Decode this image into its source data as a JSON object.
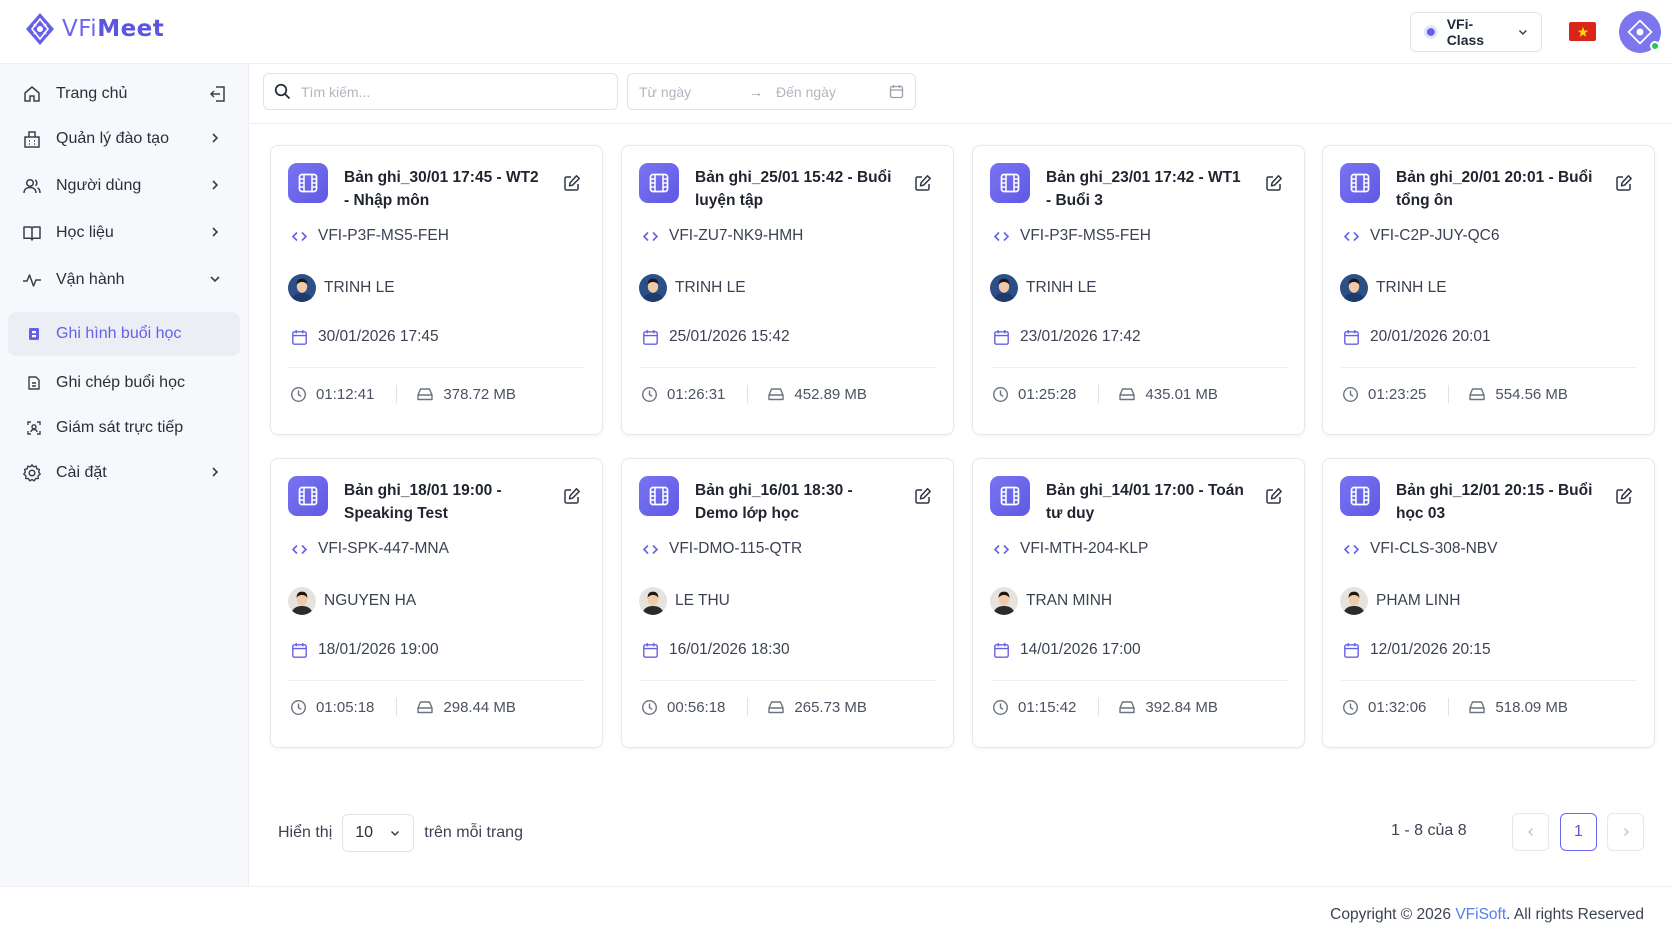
{
  "app": {
    "logo_text_a": "VFi",
    "logo_text_b": "Meet",
    "class_switch": "VFi-Class",
    "brand_color": "#5b55e0"
  },
  "sidebar": {
    "items": [
      {
        "label": "Trang chủ",
        "icon": "home-icon"
      },
      {
        "label": "Quản lý đào tạo",
        "icon": "training-icon"
      },
      {
        "label": "Người dùng",
        "icon": "users-icon"
      },
      {
        "label": "Học liệu",
        "icon": "book-icon"
      },
      {
        "label": "Vận hành",
        "icon": "activity-icon"
      },
      {
        "label": "Ghi hình buổi học",
        "icon": "record-icon"
      },
      {
        "label": "Ghi chép buổi học",
        "icon": "notes-icon"
      },
      {
        "label": "Giám sát trực tiếp",
        "icon": "monitor-icon"
      },
      {
        "label": "Cài đặt",
        "icon": "gear-icon"
      }
    ]
  },
  "toolbar": {
    "search_placeholder": "Tìm kiếm...",
    "date_from": "Từ ngày",
    "date_to": "Đến ngày"
  },
  "recordings": [
    {
      "title": "Bản ghi_30/01 17:45 - WT2 - Nhập môn",
      "code": "VFI-P3F-MS5-FEH",
      "user": "TRINH LE",
      "date": "30/01/2026 17:45",
      "duration": "01:12:41",
      "size": "378.72 MB"
    },
    {
      "title": "Bản ghi_25/01 15:42 - Buổi luyện tập",
      "code": "VFI-ZU7-NK9-HMH",
      "user": "TRINH LE",
      "date": "25/01/2026 15:42",
      "duration": "01:26:31",
      "size": "452.89 MB"
    },
    {
      "title": "Bản ghi_23/01 17:42 - WT1 - Buổi 3",
      "code": "VFI-P3F-MS5-FEH",
      "user": "TRINH LE",
      "date": "23/01/2026 17:42",
      "duration": "01:25:28",
      "size": "435.01 MB"
    },
    {
      "title": "Bản ghi_20/01 20:01 - Buổi tổng ôn",
      "code": "VFI-C2P-JUY-QC6",
      "user": "TRINH LE",
      "date": "20/01/2026 20:01",
      "duration": "01:23:25",
      "size": "554.56 MB"
    },
    {
      "title": "Bản ghi_18/01 19:00 - Speaking Test",
      "code": "VFI-SPK-447-MNA",
      "user": "NGUYEN HA",
      "date": "18/01/2026 19:00",
      "duration": "01:05:18",
      "size": "298.44 MB"
    },
    {
      "title": "Bản ghi_16/01 18:30 - Demo lớp học",
      "code": "VFI-DMO-115-QTR",
      "user": "LE THU",
      "date": "16/01/2026 18:30",
      "duration": "00:56:18",
      "size": "265.73 MB"
    },
    {
      "title": "Bản ghi_14/01 17:00 - Toán tư duy",
      "code": "VFI-MTH-204-KLP",
      "user": "TRAN MINH",
      "date": "14/01/2026 17:00",
      "duration": "01:15:42",
      "size": "392.84 MB"
    },
    {
      "title": "Bản ghi_12/01 20:15 - Buổi học 03",
      "code": "VFI-CLS-308-NBV",
      "user": "PHAM LINH",
      "date": "12/01/2026 20:15",
      "duration": "01:32:06",
      "size": "518.09 MB"
    }
  ],
  "pagination": {
    "show_label": "Hiển thị",
    "page_size": "10",
    "per_page_label": "trên mỗi trang",
    "range": "1 - 8 của 8",
    "current_page": "1"
  },
  "footer": {
    "prefix": "Copyright © 2026 ",
    "brand": "VFiSoft",
    "suffix": ". All rights Reserved"
  }
}
